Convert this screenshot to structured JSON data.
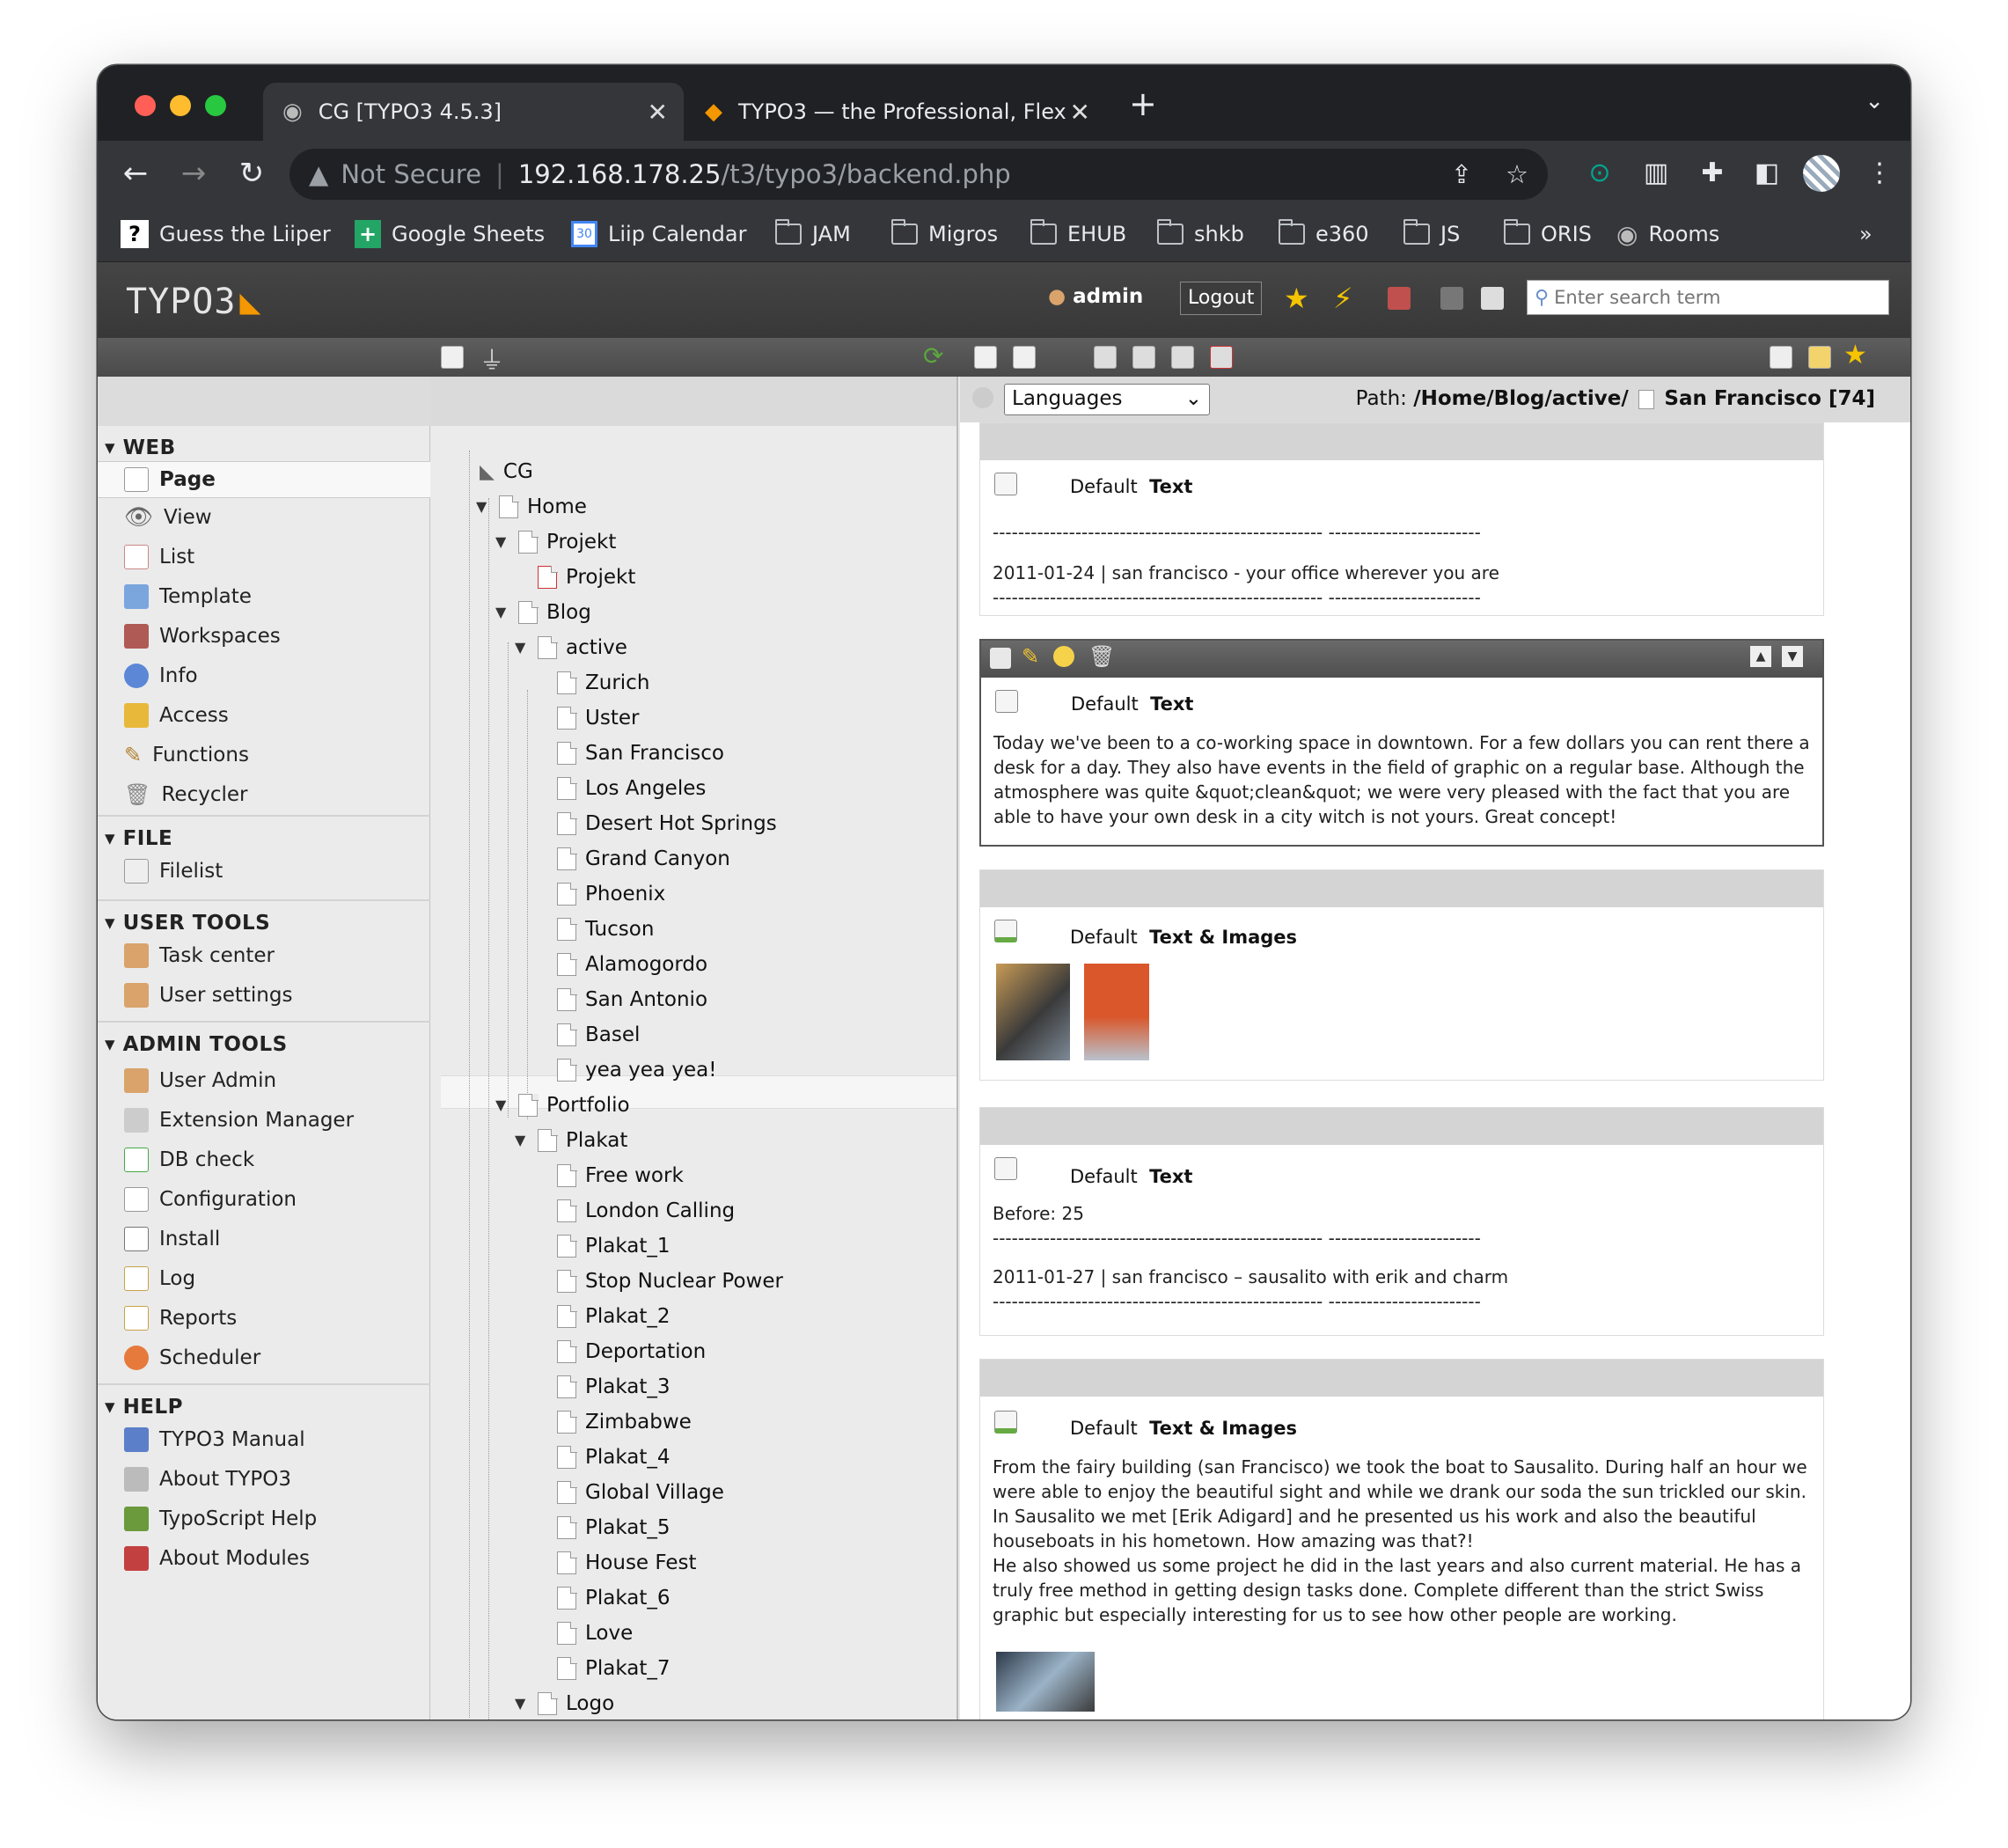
{
  "browser": {
    "tabs": [
      {
        "title": "CG [TYPO3 4.5.3]"
      },
      {
        "title": "TYPO3 — the Professional, Flex"
      }
    ],
    "url_prefix": "Not Secure",
    "url_host": "192.168.178.25",
    "url_path": "/t3/typo3/backend.php",
    "bookmarks": [
      {
        "label": "Guess the Liiper",
        "icon": "question-icon"
      },
      {
        "label": "Google Sheets",
        "icon": "sheets-icon"
      },
      {
        "label": "Liip Calendar",
        "icon": "calendar-icon"
      },
      {
        "label": "JAM",
        "icon": "folder-icon"
      },
      {
        "label": "Migros",
        "icon": "folder-icon"
      },
      {
        "label": "EHUB",
        "icon": "folder-icon"
      },
      {
        "label": "shkb",
        "icon": "folder-icon"
      },
      {
        "label": "e360",
        "icon": "folder-icon"
      },
      {
        "label": "JS",
        "icon": "folder-icon"
      },
      {
        "label": "ORIS",
        "icon": "folder-icon"
      },
      {
        "label": "Rooms",
        "icon": "globe-icon"
      }
    ],
    "bookmarks_more": "»"
  },
  "typo3": {
    "logo": "TYPO3",
    "user": "admin",
    "logout": "Logout",
    "search_placeholder": "Enter search term",
    "modules": {
      "web": {
        "title": "WEB",
        "items": [
          "Page",
          "View",
          "List",
          "Template",
          "Workspaces",
          "Info",
          "Access",
          "Functions",
          "Recycler"
        ]
      },
      "file": {
        "title": "FILE",
        "items": [
          "Filelist"
        ]
      },
      "user_tools": {
        "title": "USER TOOLS",
        "items": [
          "Task center",
          "User settings"
        ]
      },
      "admin_tools": {
        "title": "ADMIN TOOLS",
        "items": [
          "User Admin",
          "Extension Manager",
          "DB check",
          "Configuration",
          "Install",
          "Log",
          "Reports",
          "Scheduler"
        ]
      },
      "help": {
        "title": "HELP",
        "items": [
          "TYPO3 Manual",
          "About TYPO3",
          "TypoScript Help",
          "About Modules"
        ]
      }
    },
    "tree": [
      "CG",
      "Home",
      "Projekt",
      "Projekt",
      "Blog",
      "active",
      "Zurich",
      "Uster",
      "San Francisco",
      "Los Angeles",
      "Desert Hot Springs",
      "Grand Canyon",
      "Phoenix",
      "Tucson",
      "Alamogordo",
      "San Antonio",
      "Basel",
      "yea yea yea!",
      "Portfolio",
      "Plakat",
      "Free work",
      "London Calling",
      "Plakat_1",
      "Stop Nuclear Power",
      "Plakat_2",
      "Deportation",
      "Plakat_3",
      "Zimbabwe",
      "Plakat_4",
      "Global Village",
      "Plakat_5",
      "House Fest",
      "Plakat_6",
      "Love",
      "Plakat_7",
      "Logo"
    ],
    "languages_select": "Languages",
    "path_label": "Path:",
    "path_value": "/Home/Blog/active/",
    "page_title": "San Francisco [74]",
    "elements": [
      {
        "type_default": "Default",
        "type": "Text",
        "dash": "---------------------------------------------------- ------------------------",
        "line": "2011-01-24 | san francisco - your office wherever you are"
      },
      {
        "type_default": "Default",
        "type": "Text",
        "body": "Today we've been to a co-working space in downtown. For a few dollars you can rent there a desk for a day. They also have events in the field of graphic on a regular base. Although the atmosphere was quite &quot;clean&quot; we were very pleased with the fact that you are able to have your own desk in a city witch is not yours. Great concept!"
      },
      {
        "type_default": "Default",
        "type": "Text & Images"
      },
      {
        "type_default": "Default",
        "type": "Text",
        "before": "Before: 25",
        "dash": "---------------------------------------------------- ------------------------",
        "line": "2011-01-27 | san francisco – sausalito with erik and charm"
      },
      {
        "type_default": "Default",
        "type": "Text & Images",
        "body": "From the fairy building (san Francisco) we took the boat to Sausalito. During half an hour we were able to enjoy the beautiful sight and while we drank our soda the sun trickled our skin.\nIn Sausalito we met [Erik Adigard] and he presented us his work and also the beautiful houseboats in his hometown. How amazing was that?!\nHe also showed us some project he did in the last years and also current material. He has a truly free method in getting design tasks done. Complete different than the strict Swiss graphic but especially interesting for us to see how other people are working."
      }
    ]
  }
}
